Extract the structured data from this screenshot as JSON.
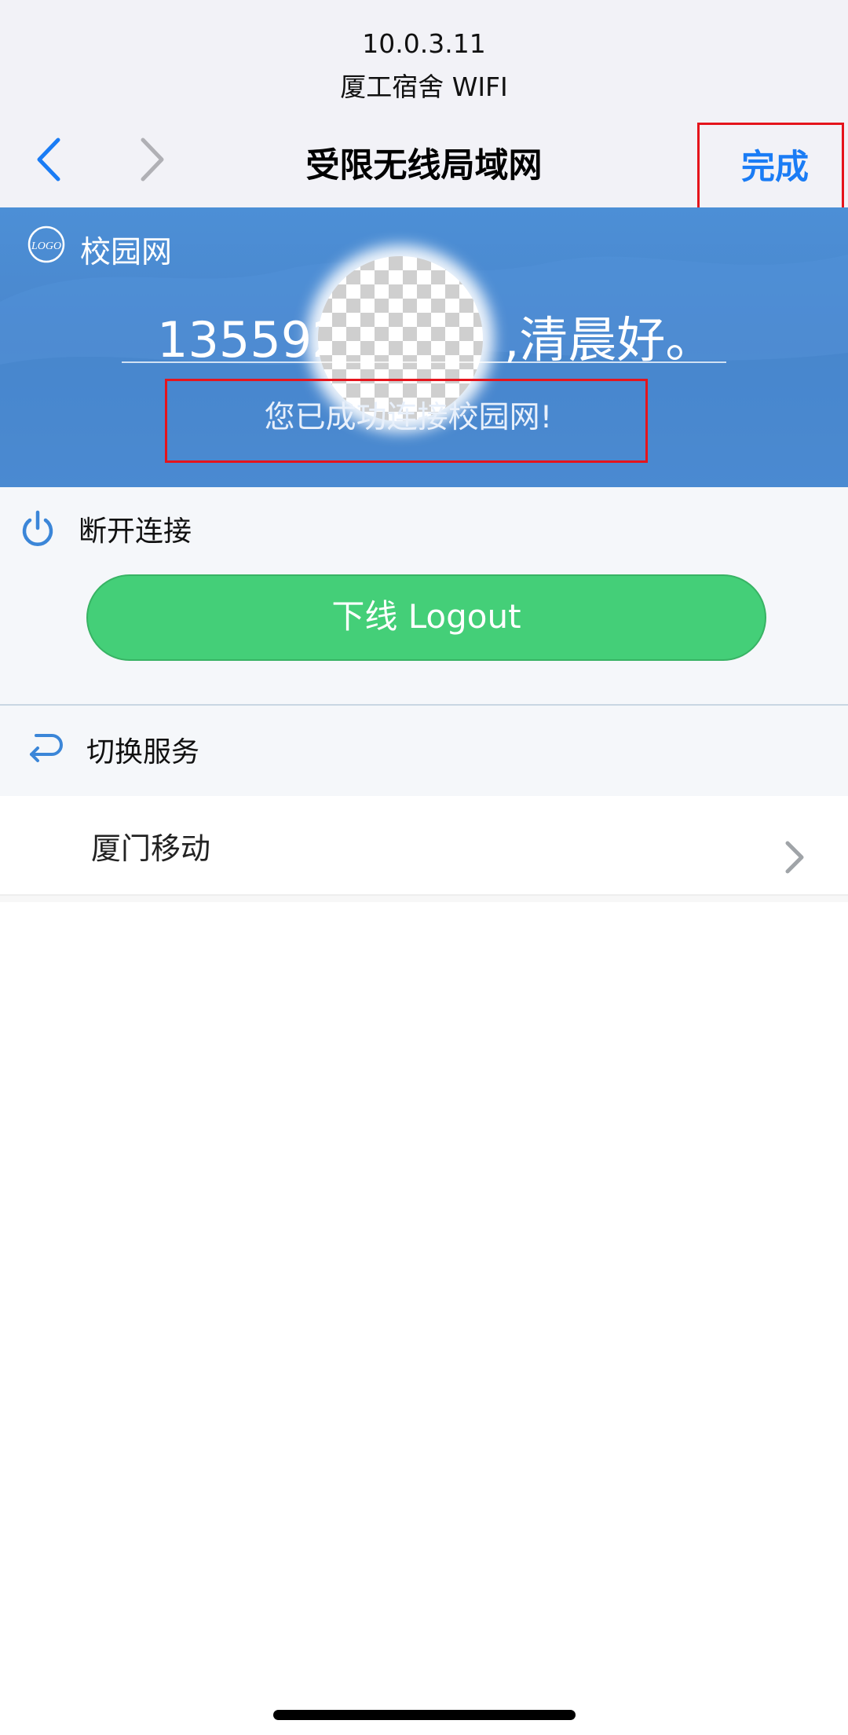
{
  "browser": {
    "ip": "10.0.3.11",
    "network_name": "厦工宿舍 WIFI",
    "title": "受限无线局域网",
    "done_label": "完成",
    "back_icon": "chevron-left-icon",
    "forward_icon": "chevron-right-icon",
    "accent_color": "#1a7cf5"
  },
  "banner": {
    "logo_text": "LOGO",
    "site_name": "校园网",
    "greeting_visible_prefix": "135592",
    "greeting_visible_suffix": ",清晨好。",
    "status_text": "您已成功连接校园网!",
    "background_color": "#4a8ad2"
  },
  "disconnect": {
    "icon": "power-icon",
    "label": "断开连接",
    "logout_label": "下线 Logout",
    "button_color": "#44cf78"
  },
  "switch_service": {
    "icon": "switch-arrow-icon",
    "label": "切换服务",
    "items": [
      {
        "name": "厦门移动",
        "icon": "chevron-right-icon"
      }
    ]
  },
  "annotation_color": "#e5141c"
}
